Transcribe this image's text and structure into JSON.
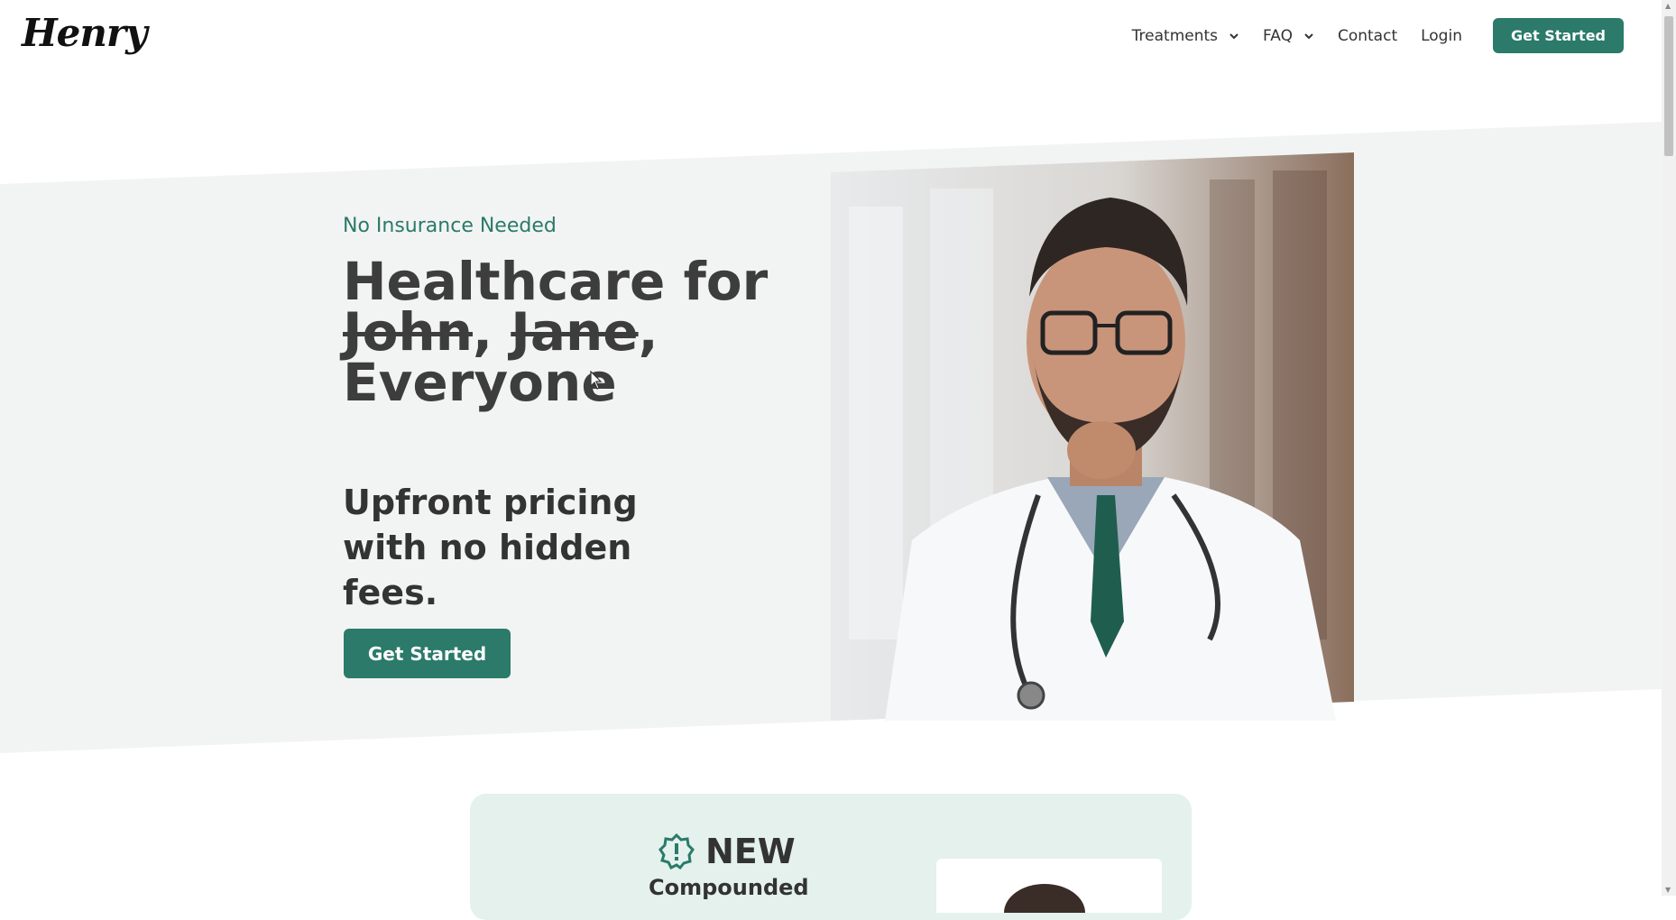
{
  "header": {
    "logo": "Henry",
    "nav": [
      {
        "label": "Treatments",
        "has_dropdown": true
      },
      {
        "label": "FAQ",
        "has_dropdown": true
      },
      {
        "label": "Contact",
        "has_dropdown": false
      },
      {
        "label": "Login",
        "has_dropdown": false
      }
    ],
    "cta": "Get Started"
  },
  "hero": {
    "eyebrow": "No Insurance Needed",
    "headline_line1": "Healthcare for",
    "struck_name1": "John",
    "struck_name2": "Jane",
    "separator1": ", ",
    "separator2": ",",
    "headline_line3": "Everyone",
    "subhead": "Upfront pricing with no hidden fees.",
    "cta": "Get Started"
  },
  "promo_card": {
    "badge_icon": "alert-badge-icon",
    "label": "NEW",
    "sub": "Compounded"
  },
  "colors": {
    "brand_green": "#2b7a6a",
    "hero_bg": "#f2f4f3",
    "card_bg": "#e4f1ed",
    "text_dark": "#3d3d3d"
  }
}
